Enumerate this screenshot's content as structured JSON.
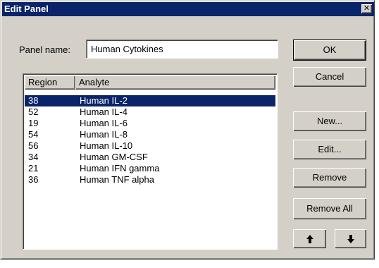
{
  "window": {
    "title": "Edit Panel",
    "close_glyph": "✕"
  },
  "panel_name": {
    "label": "Panel name:",
    "value": "Human Cytokines"
  },
  "list": {
    "columns": [
      "Region",
      "Analyte"
    ],
    "rows": [
      {
        "region": "38",
        "analyte": "Human IL-2",
        "selected": true
      },
      {
        "region": "52",
        "analyte": "Human IL-4"
      },
      {
        "region": "19",
        "analyte": "Human IL-6"
      },
      {
        "region": "54",
        "analyte": "Human IL-8"
      },
      {
        "region": "56",
        "analyte": "Human IL-10"
      },
      {
        "region": "34",
        "analyte": "Human GM-CSF"
      },
      {
        "region": "21",
        "analyte": "Human IFN gamma"
      },
      {
        "region": "36",
        "analyte": "Human TNF alpha"
      }
    ]
  },
  "buttons": {
    "ok": "OK",
    "cancel": "Cancel",
    "new": "New...",
    "edit": "Edit...",
    "remove": "Remove",
    "remove_all": "Remove All",
    "move_up_icon": "arrow-up-icon",
    "move_down_icon": "arrow-down-icon"
  },
  "colors": {
    "titlebar": "#0a246a",
    "selection": "#0a246a",
    "face": "#d4d0c8"
  }
}
